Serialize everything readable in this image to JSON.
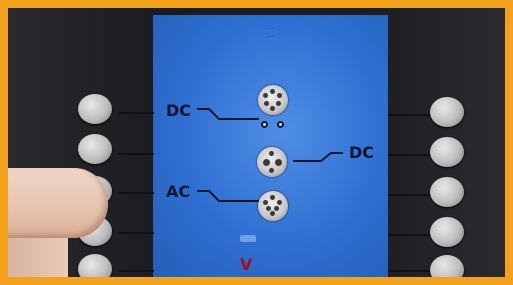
{
  "screen": {
    "header_line1": "...",
    "header_line2": "..."
  },
  "labels": {
    "dc_left": "DC",
    "dc_right": "DC",
    "ac_left": "AC",
    "bottom_mark": "V"
  },
  "colors": {
    "frame": "#f2a31b",
    "screen": "#2f6fd1",
    "bezel": "#1b1c20",
    "label": "#0a1530",
    "bottom_mark": "#a01010"
  }
}
